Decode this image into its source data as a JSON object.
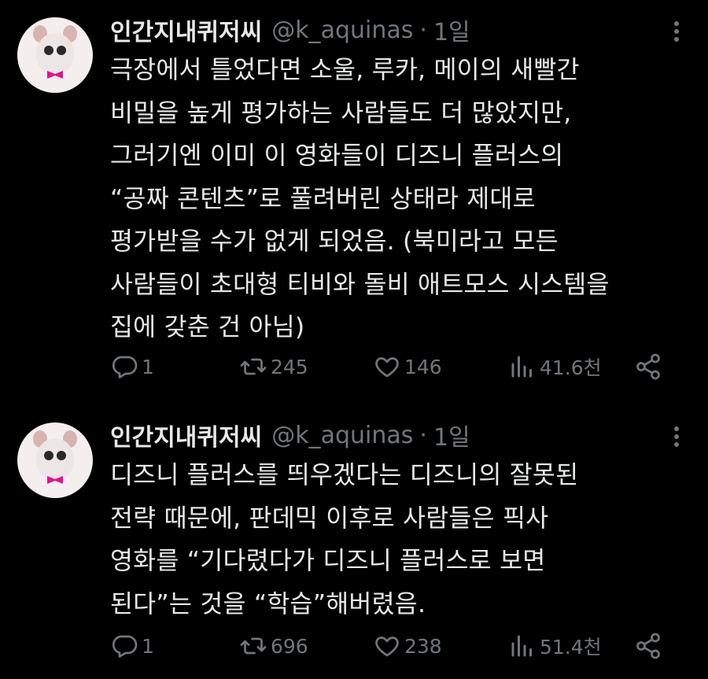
{
  "tweets": [
    {
      "display_name": "인간지내퀴저씨",
      "handle": "@k_aquinas",
      "separator": "·",
      "time": "1일",
      "body": "극장에서 틀었다면 소울, 루카, 메이의 새빨간\n비밀을 높게 평가하는 사람들도 더 많았지만,\n그러기엔 이미 이 영화들이 디즈니 플러스의\n“공짜 콘텐츠”로 풀려버린 상태라 제대로\n평가받을 수가 없게 되었음. (북미라고 모든\n사람들이 초대형 티비와 돌비 애트모스 시스템을\n집에 갖춘 건 아님)",
      "replies": "1",
      "retweets": "245",
      "likes": "146",
      "views": "41.6천"
    },
    {
      "display_name": "인간지내퀴저씨",
      "handle": "@k_aquinas",
      "separator": "·",
      "time": "1일",
      "body": "디즈니 플러스를 띄우겠다는 디즈니의 잘못된\n전략 때문에, 판데믹 이후로 사람들은 픽사\n영화를 “기다렸다가 디즈니 플러스로 보면\n된다”는 것을 “학습”해버렸음.",
      "replies": "1",
      "retweets": "696",
      "likes": "238",
      "views": "51.4천"
    }
  ],
  "icons": {
    "avatar": "pig-character-avatar",
    "more": "more-vertical-icon",
    "reply": "reply-icon",
    "retweet": "retweet-icon",
    "like": "heart-icon",
    "views": "views-icon",
    "share": "share-icon"
  },
  "colors": {
    "background": "#000000",
    "primary_text": "#e7e9ea",
    "secondary_text": "#71767b",
    "avatar_bow": "#e0138f"
  }
}
